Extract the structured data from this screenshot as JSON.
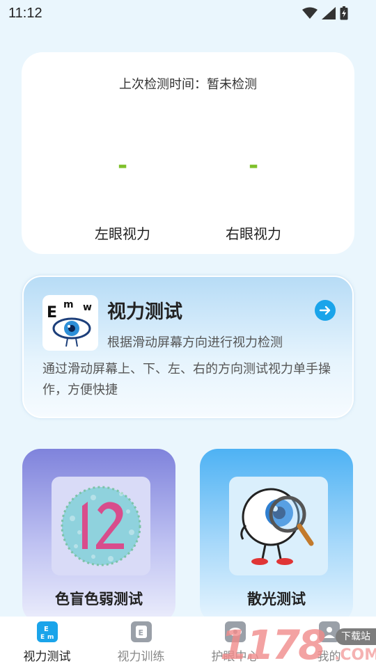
{
  "status_bar": {
    "time": "11:12"
  },
  "result_card": {
    "last_test_label": "上次检测时间：暂未检测",
    "left_eye": {
      "value": "-",
      "label": "左眼视力"
    },
    "right_eye": {
      "value": "-",
      "label": "右眼视力"
    }
  },
  "vision_test_card": {
    "title": "视力测试",
    "subtitle": "根据滑动屏幕方向进行视力检测",
    "description": "通过滑动屏幕上、下、左、右的方向测试视力单手操作，方便快捷",
    "icon": "eye-chart-icon",
    "arrow_icon": "arrow-right-icon"
  },
  "feature_cards": [
    {
      "title": "色盲色弱测试",
      "icon": "color-blind-plate-icon"
    },
    {
      "title": "散光测试",
      "icon": "eyeball-magnifier-icon"
    }
  ],
  "tab_bar": [
    {
      "label": "视力测试",
      "active": true,
      "icon": "em-chart-icon"
    },
    {
      "label": "视力训练",
      "active": false,
      "icon": "e-chart-icon"
    },
    {
      "label": "护眼中心",
      "active": false,
      "icon": "eye-care-icon"
    },
    {
      "label": "我的",
      "active": false,
      "icon": "profile-icon"
    }
  ],
  "watermark": {
    "number": "1178",
    "badge": "下载站",
    "domain": ".COM"
  },
  "colors": {
    "accent_green": "#7ec02a",
    "accent_blue": "#1aa4ea",
    "background": "#eaf6fd"
  }
}
